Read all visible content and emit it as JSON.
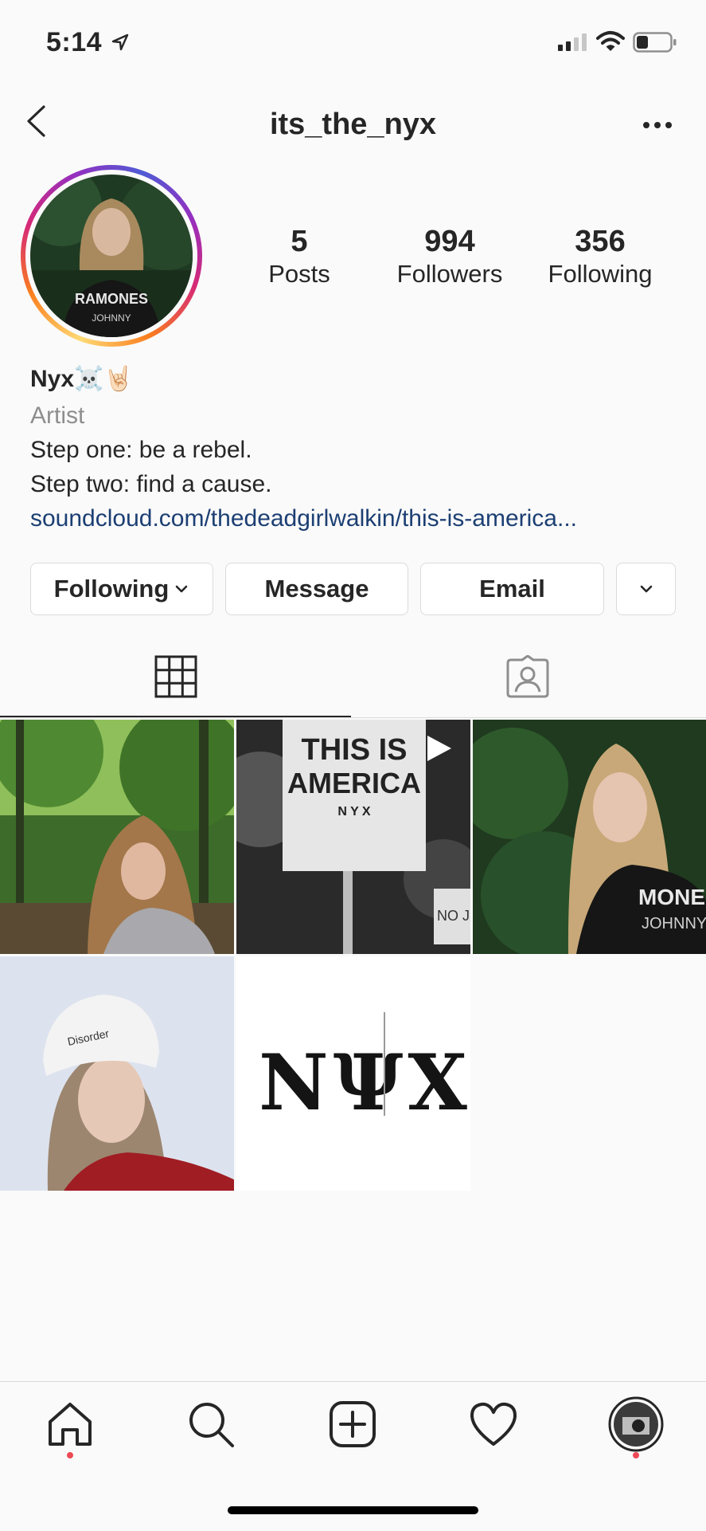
{
  "status_bar": {
    "time": "5:14"
  },
  "header": {
    "username": "its_the_nyx"
  },
  "stats": [
    {
      "count": "5",
      "label": "Posts"
    },
    {
      "count": "994",
      "label": "Followers"
    },
    {
      "count": "356",
      "label": "Following"
    }
  ],
  "bio": {
    "display_name": "Nyx☠️🤘🏻",
    "category": "Artist",
    "line1": "Step one: be a rebel.",
    "line2": "Step two: find a cause.",
    "link": "soundcloud.com/thedeadgirlwalkin/this-is-america..."
  },
  "actions": {
    "following_label": "Following",
    "message_label": "Message",
    "email_label": "Email"
  },
  "posts": [
    {
      "description": "forest portrait"
    },
    {
      "description": "protest sign",
      "sign_line1": "THIS IS",
      "sign_line2": "AMERICA",
      "sign_line3": "N Y X",
      "sign_small": "NO JU"
    },
    {
      "description": "portrait with ivy"
    },
    {
      "description": "beanie portrait",
      "beanie_text": "Disorder"
    },
    {
      "description": "logo",
      "logo_text": "NΨX"
    }
  ],
  "avatar_shirt_text": "RAMONES",
  "avatar_shirt_sub": "JOHNNY",
  "post3_shirt_text": "MONES",
  "post3_shirt_sub": "JOHNNY",
  "colors": {
    "link": "#1c3f73",
    "notification_dot": "#ed4956",
    "border": "#dbdbdb"
  }
}
